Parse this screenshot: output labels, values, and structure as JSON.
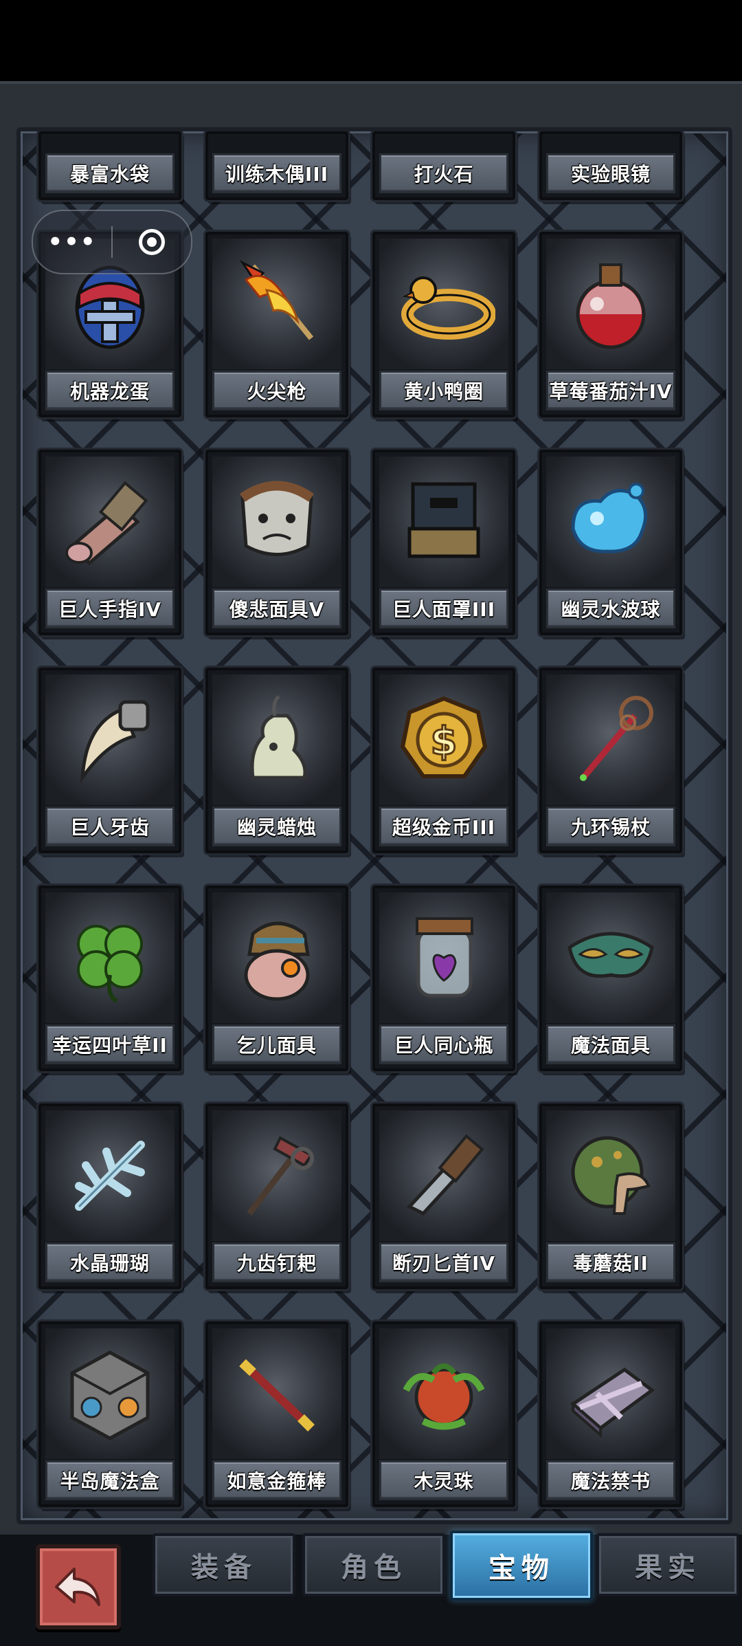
{
  "menu": {
    "more_icon": "more-dots-icon",
    "close_icon": "target-circle-icon"
  },
  "treasures": [
    {
      "name": "暴富水袋",
      "icon": "money-bag"
    },
    {
      "name": "训练木偶III",
      "icon": "training-dummy"
    },
    {
      "name": "打火石",
      "icon": "flint"
    },
    {
      "name": "实验眼镜",
      "icon": "goggles"
    },
    {
      "name": "机器龙蛋",
      "icon": "mech-dragon-egg"
    },
    {
      "name": "火尖枪",
      "icon": "fire-spear"
    },
    {
      "name": "黄小鸭圈",
      "icon": "duck-float"
    },
    {
      "name": "草莓番茄汁IV",
      "icon": "red-potion"
    },
    {
      "name": "巨人手指IV",
      "icon": "giant-finger"
    },
    {
      "name": "傻悲面具V",
      "icon": "sad-mask"
    },
    {
      "name": "巨人面罩III",
      "icon": "giant-visor"
    },
    {
      "name": "幽灵水波球",
      "icon": "water-blob"
    },
    {
      "name": "巨人牙齿",
      "icon": "giant-tooth"
    },
    {
      "name": "幽灵蜡烛",
      "icon": "ghost-candle"
    },
    {
      "name": "超级金币III",
      "icon": "gold-coin"
    },
    {
      "name": "九环锡杖",
      "icon": "ring-staff"
    },
    {
      "name": "幸运四叶草II",
      "icon": "four-leaf-clover"
    },
    {
      "name": "乞儿面具",
      "icon": "beggar-mask"
    },
    {
      "name": "巨人同心瓶",
      "icon": "heart-jar"
    },
    {
      "name": "魔法面具",
      "icon": "magic-mask"
    },
    {
      "name": "水晶珊瑚",
      "icon": "crystal-coral"
    },
    {
      "name": "九齿钉耙",
      "icon": "rake"
    },
    {
      "name": "断刃匕首IV",
      "icon": "broken-dagger"
    },
    {
      "name": "毒蘑菇II",
      "icon": "poison-mushroom"
    },
    {
      "name": "半岛魔法盒",
      "icon": "magic-cube"
    },
    {
      "name": "如意金箍棒",
      "icon": "golden-staff"
    },
    {
      "name": "木灵珠",
      "icon": "wood-orb"
    },
    {
      "name": "魔法禁书",
      "icon": "forbidden-book"
    }
  ],
  "back_button": {
    "icon": "back-arrow-icon"
  },
  "tabs": [
    {
      "label": "装备"
    },
    {
      "label": "角色"
    },
    {
      "label": "宝物"
    },
    {
      "label": "果实"
    }
  ],
  "active_tab": "宝物"
}
